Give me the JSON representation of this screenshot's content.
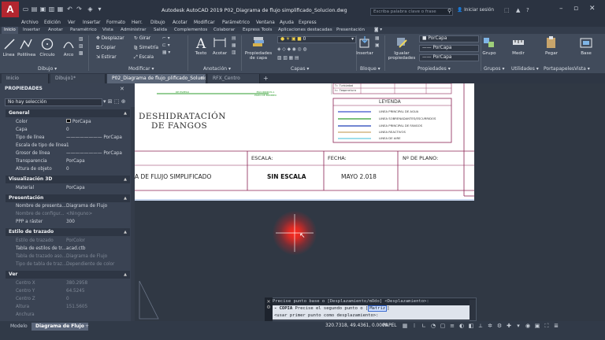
{
  "app": {
    "logo_letter": "A",
    "window_title": "Autodesk AutoCAD 2019   P02_Diagrama de flujo simplificado_Solucion.dwg",
    "search_placeholder": "Escriba palabra clave o frase",
    "login_label": "Iniciar sesión"
  },
  "menu": [
    "Archivo",
    "Edición",
    "Ver",
    "Insertar",
    "Formato",
    "Herr.",
    "Dibujo",
    "Acotar",
    "Modificar",
    "Parámetrico",
    "Ventana",
    "Ayuda",
    "Express"
  ],
  "ribbon_tabs": [
    {
      "label": "Inicio",
      "active": true
    },
    {
      "label": "Insertar",
      "active": false
    },
    {
      "label": "Anotar",
      "active": false
    },
    {
      "label": "Paramétrico",
      "active": false
    },
    {
      "label": "Vista",
      "active": false
    },
    {
      "label": "Administrar",
      "active": false
    },
    {
      "label": "Salida",
      "active": false
    },
    {
      "label": "Complementos",
      "active": false
    },
    {
      "label": "Colaborar",
      "active": false
    },
    {
      "label": "Express Tools",
      "active": false
    },
    {
      "label": "Aplicaciones destacadas",
      "active": false
    },
    {
      "label": "Presentación",
      "active": false
    }
  ],
  "ribbon": {
    "draw_buttons": [
      "Línea",
      "Polilínea",
      "Círculo",
      "Arco"
    ],
    "draw_panel": "Dibujo",
    "modify_buttons": [
      "Desplazar",
      "Girar",
      "Copiar",
      "Simetría",
      "Estirar",
      "Escala"
    ],
    "modify_panel": "Modificar",
    "annotation_buttons": [
      "Texto",
      "Acotar"
    ],
    "annotation_panel": "Anotación",
    "layer_buttons": [
      "Propiedades de capa"
    ],
    "layer_value": "0",
    "layers_panel": "Capas",
    "block_buttons": [
      "Insertar"
    ],
    "block_panel": "Bloque",
    "props_button": "Igualar propiedades",
    "props_values": [
      "PorCapa",
      "PorCapa",
      "PorCapa"
    ],
    "props_panel": "Propiedades",
    "groups_button": "Grupo",
    "groups_panel": "Grupos",
    "utils_button": "Medir",
    "utils_panel": "Utilidades",
    "clip_button": "Pegar",
    "clip_panel": "Portapapeles",
    "view_button": "Base",
    "view_panel": "Vista"
  },
  "doc_tabs": [
    {
      "label": "Inicio",
      "active": false
    },
    {
      "label": "Dibujo1*",
      "active": false
    },
    {
      "label": "P02_Diagrama de flujo_plificado_Solucion*",
      "active": true
    },
    {
      "label": "RFX_Centro",
      "active": false
    }
  ],
  "palette": {
    "title": "PROPIEDADES",
    "selection": "No hay selección",
    "sections": [
      {
        "title": "General",
        "rows": [
          {
            "k": "Color",
            "v": "PorCapa",
            "dim": false
          },
          {
            "k": "Capa",
            "v": "0",
            "dim": false
          },
          {
            "k": "Tipo de línea",
            "v": "PorCapa",
            "dim": false
          },
          {
            "k": "Escala de tipo de línea",
            "v": "1",
            "dim": false
          },
          {
            "k": "Grosor de línea",
            "v": "PorCapa",
            "dim": false
          },
          {
            "k": "Transparencia",
            "v": "PorCapa",
            "dim": false
          },
          {
            "k": "Altura de objeto",
            "v": "0",
            "dim": false
          }
        ]
      },
      {
        "title": "Visualización 3D",
        "rows": [
          {
            "k": "Material",
            "v": "PorCapa",
            "dim": false
          }
        ]
      },
      {
        "title": "Presentación",
        "rows": [
          {
            "k": "Nombre de presenta...",
            "v": "Diagrama de Flujo",
            "dim": false
          },
          {
            "k": "Nombre de configur...",
            "v": "<Ninguno>",
            "dim": true
          },
          {
            "k": "PPP a ráster",
            "v": "300",
            "dim": false
          }
        ]
      },
      {
        "title": "Estilo de trazado",
        "rows": [
          {
            "k": "Estilo de trazado",
            "v": "PorColor",
            "dim": true
          },
          {
            "k": "Tabla de estilos de tr...",
            "v": "acad.ctb",
            "dim": false
          },
          {
            "k": "Tabla de trazado aso...",
            "v": "Diagrama de Flujo",
            "dim": true
          },
          {
            "k": "Tipo de tabla de traz...",
            "v": "Dependiente de color",
            "dim": true
          }
        ]
      },
      {
        "title": "Ver",
        "rows": [
          {
            "k": "Centro X",
            "v": "380.2958",
            "dim": true
          },
          {
            "k": "Centro Y",
            "v": "64.5245",
            "dim": true
          },
          {
            "k": "Centro Z",
            "v": "0",
            "dim": true
          },
          {
            "k": "Altura",
            "v": "151.5605",
            "dim": true
          },
          {
            "k": "Anchura",
            "v": "",
            "dim": true
          }
        ]
      }
    ]
  },
  "drawing": {
    "title_line1": "DESHIDRATACIÓN",
    "title_line2": "DE FANGOS",
    "small_label_1": "DE ESPESO",
    "small_label_2": "ESCURRIDOS A",
    "small_label_3": "POZO DE BOMBEO",
    "legend_title": "LEYENDA",
    "legend_header_1": "T= Turbiedad",
    "legend_header_2": "t= Temperatura",
    "legend_items": [
      {
        "label": "LINEA PRINCIPAL DE AGUA",
        "color": "#3a52c9"
      },
      {
        "label": "LINEA SOBRENADANTES/ESCURRIDOS",
        "color": "#2f9e2f"
      },
      {
        "label": "LINEA PRINCIPAL DE FANGOS",
        "color": "#1f3fb8"
      },
      {
        "label": "LINEA REACTIVOS",
        "color": "#c9a86a"
      },
      {
        "label": "LINEA DE AIRE",
        "color": "#7fd3e6"
      }
    ],
    "headers": [
      "ESCALA:",
      "FECHA:",
      "Nº DE PLANO:"
    ],
    "diagram_title": "A DE FLUJO SIMPLIFICADO",
    "scale_value": "SIN ESCALA",
    "date_value": "MAYO 2.018"
  },
  "command": {
    "line1": "Precise punto base o [Desplazamiento/mOdo] <Desplazamiento>:",
    "line2_cmd": "- COPIA",
    "line2_text": "Precise el segundo punto o [",
    "line2_opt": "Matriz",
    "line2_end": "]",
    "line3": "<usar primer punto como desplazamiento>:"
  },
  "status": {
    "layout_tabs": [
      {
        "label": "Modelo",
        "active": false
      },
      {
        "label": "Diagrama de Flujo",
        "active": true
      }
    ],
    "add_tab": "+",
    "coords": "320.7318, 49.4361, 0.0000",
    "space": "PAPEL"
  },
  "colors": {
    "accent_red": "#e3262b",
    "drawing_line": "#8b2252"
  }
}
